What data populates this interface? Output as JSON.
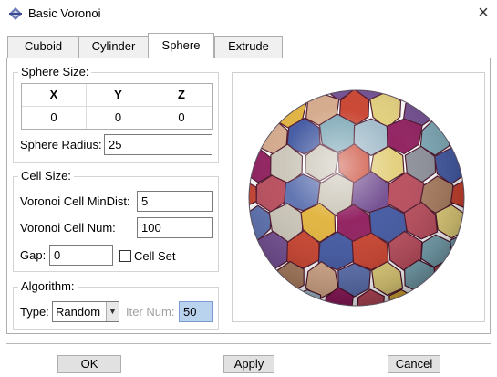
{
  "window": {
    "title": "Basic Voronoi",
    "icon": "app-diamond-icon",
    "close_icon": "close-icon"
  },
  "tabs": [
    {
      "label": "Cuboid",
      "active": false
    },
    {
      "label": "Cylinder",
      "active": false
    },
    {
      "label": "Sphere",
      "active": true
    },
    {
      "label": "Extrude",
      "active": false
    }
  ],
  "sphere_size": {
    "title": "Sphere Size:",
    "columns": [
      "X",
      "Y",
      "Z"
    ],
    "values": [
      "0",
      "0",
      "0"
    ],
    "radius_label": "Sphere Radius:",
    "radius_value": "25"
  },
  "cell_size": {
    "title": "Cell Size:",
    "min_dist_label": "Voronoi Cell MinDist:",
    "min_dist_value": "5",
    "cell_num_label": "Voronoi Cell Num:",
    "cell_num_value": "100",
    "gap_label": "Gap:",
    "gap_value": "0",
    "cell_set_label": "Cell Set",
    "cell_set_checked": false
  },
  "algorithm": {
    "title": "Algorithm:",
    "type_label": "Type:",
    "type_value": "Random",
    "iter_label": "Iter Num:",
    "iter_value": "50"
  },
  "buttons": {
    "ok": "OK",
    "apply": "Apply",
    "cancel": "Cancel"
  },
  "colors": {
    "accent": "#b9d3ee",
    "cell_palette": [
      "#8e1a5c",
      "#6f4a8e",
      "#e0b23a",
      "#3f56a0",
      "#c8402c",
      "#9fb9c8",
      "#d4a889",
      "#b84a5a",
      "#e2cf7a",
      "#5a6fae",
      "#8d8f9a",
      "#c9c4b6",
      "#7aa6b4",
      "#a97c5e"
    ],
    "cell_edge": "#4a1028"
  }
}
